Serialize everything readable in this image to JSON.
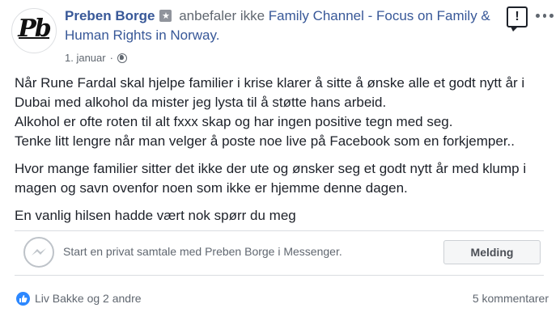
{
  "post": {
    "author": "Preben Borge",
    "action": "anbefaler ikke",
    "page": "Family Channel - Focus on Family & Human Rights in Norway.",
    "date": "1. januar",
    "separator": "·",
    "audience_icon": "globe-icon",
    "avatar_initials": "Pb",
    "paragraphs": [
      "Når Rune Fardal skal hjelpe familier i krise klarer å sitte å ønske alle et godt nytt år i Dubai med alkohol da mister jeg lysta til å støtte hans arbeid.\nAlkohol er ofte roten til alt fxxx skap og har ingen positive tegn med seg.\nTenke litt lengre når man velger å poste noe live på Facebook som en forkjemper..",
      "Hvor mange familier sitter det ikke der ute og ønsker seg et godt nytt år med klump i magen og savn ovenfor noen som ikke er hjemme denne dagen.",
      "En vanlig hilsen hadde vært nok spørr du meg"
    ]
  },
  "header_buttons": {
    "report_symbol": "!"
  },
  "messenger": {
    "prompt": "Start en privat samtale med Preben Borge i Messenger.",
    "button_label": "Melding"
  },
  "footer": {
    "reactions": "Liv Bakke og 2 andre",
    "comments": "5 kommentarer"
  },
  "colors": {
    "link": "#385898",
    "muted": "#606770",
    "text": "#1d2129",
    "like_blue": "#2d88ff"
  }
}
